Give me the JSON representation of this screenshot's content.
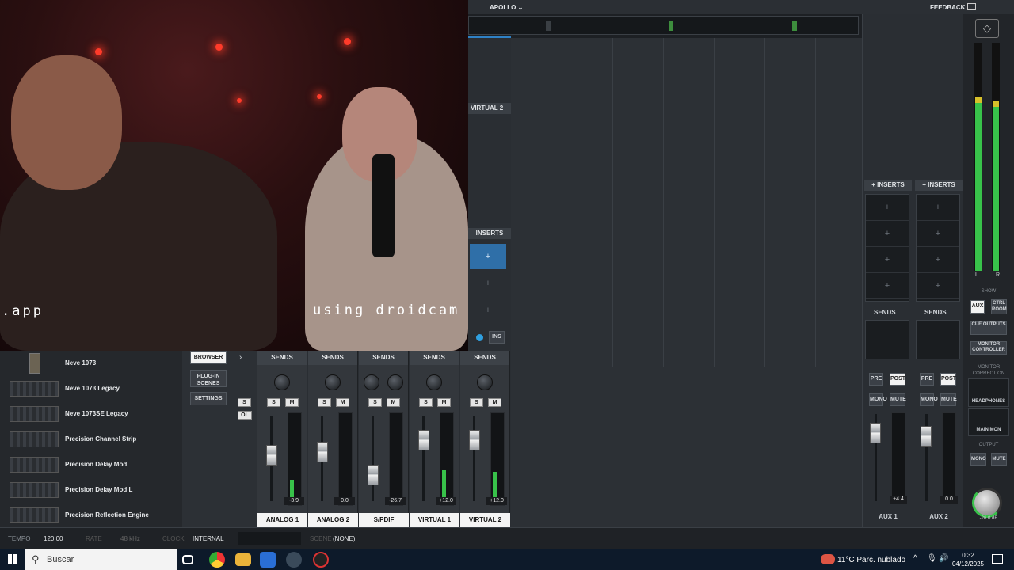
{
  "webcam": {
    "caption_left": ".app",
    "caption_right": "using droidcam"
  },
  "topbar": {
    "device": "APOLLO",
    "feedback": "FEEDBACK"
  },
  "left_strip": {
    "channel_label": "VIRTUAL 2",
    "inserts_label": "INSERTS",
    "ins_button": "INS"
  },
  "browser": {
    "items": [
      {
        "label": "Neve 1073"
      },
      {
        "label": "Neve 1073 Legacy"
      },
      {
        "label": "Neve 1073SE Legacy"
      },
      {
        "label": "Precision Channel Strip"
      },
      {
        "label": "Precision Delay Mod"
      },
      {
        "label": "Precision Delay Mod L"
      },
      {
        "label": "Precision Reflection Engine"
      }
    ]
  },
  "nav": {
    "browser": "BROWSER",
    "plugin_scenes": "PLUG-IN SCENES",
    "settings": "SETTINGS",
    "s": "S",
    "ol": "OL"
  },
  "channels": [
    {
      "sends": "SENDS",
      "name": "ANALOG 1",
      "peak": "-3.9",
      "level": 0.28,
      "fader": 0.55
    },
    {
      "sends": "SENDS",
      "name": "ANALOG 2",
      "peak": "0.0",
      "level": 0.0,
      "fader": 0.6
    },
    {
      "sends": "SENDS",
      "name": "S/PDIF",
      "peak": "-26.7",
      "level": 0.0,
      "fader": 0.25
    },
    {
      "sends": "SENDS",
      "name": "VIRTUAL 1",
      "peak": "+12.0",
      "level": 0.38,
      "fader": 0.78
    },
    {
      "sends": "SENDS",
      "name": "VIRTUAL 2",
      "peak": "+12.0",
      "level": 0.36,
      "fader": 0.78
    }
  ],
  "channel_buttons": {
    "s": "S",
    "m": "M"
  },
  "aux": [
    {
      "inserts": "+ INSERTS",
      "sends": "SENDS",
      "pre": "PRE",
      "post": "POST",
      "mono": "MONO",
      "mute": "MUTE",
      "peak": "+4.4",
      "name": "AUX 1"
    },
    {
      "inserts": "+ INSERTS",
      "sends": "SENDS",
      "pre": "PRE",
      "post": "POST",
      "mono": "MONO",
      "mute": "MUTE",
      "peak": "0.0",
      "name": "AUX 2"
    }
  ],
  "monitor": {
    "meter_l": "L",
    "meter_r": "R",
    "show": "SHOW",
    "aux": "AUX",
    "ctrl_room": "CTRL ROOM",
    "cue_outputs": "CUE OUTPUTS",
    "monitor_controller": "MONITOR CONTROLLER",
    "monitor_correction": "MONITOR CORRECTION",
    "headphones": "HEADPHONES",
    "main_mon": "MAIN MON",
    "output": "OUTPUT",
    "mono": "MONO",
    "mute": "MUTE",
    "volume": "-26.0 dB"
  },
  "status": {
    "tempo_label": "TEMPO",
    "tempo": "120.00",
    "rate_label": "RATE",
    "rate": "48 kHz",
    "clock_label": "CLOCK",
    "clock": "INTERNAL",
    "scene_label": "SCENE",
    "scene": "(NONE)"
  },
  "taskbar": {
    "search": "Buscar",
    "weather": "11°C  Parc. nublado",
    "time": "0:32",
    "date": "04/12/2025"
  },
  "colors": {
    "accent_blue": "#2f82c6",
    "meter_green": "#38c24a",
    "meter_yellow": "#d7c02a",
    "orange": "#d98a1a"
  }
}
